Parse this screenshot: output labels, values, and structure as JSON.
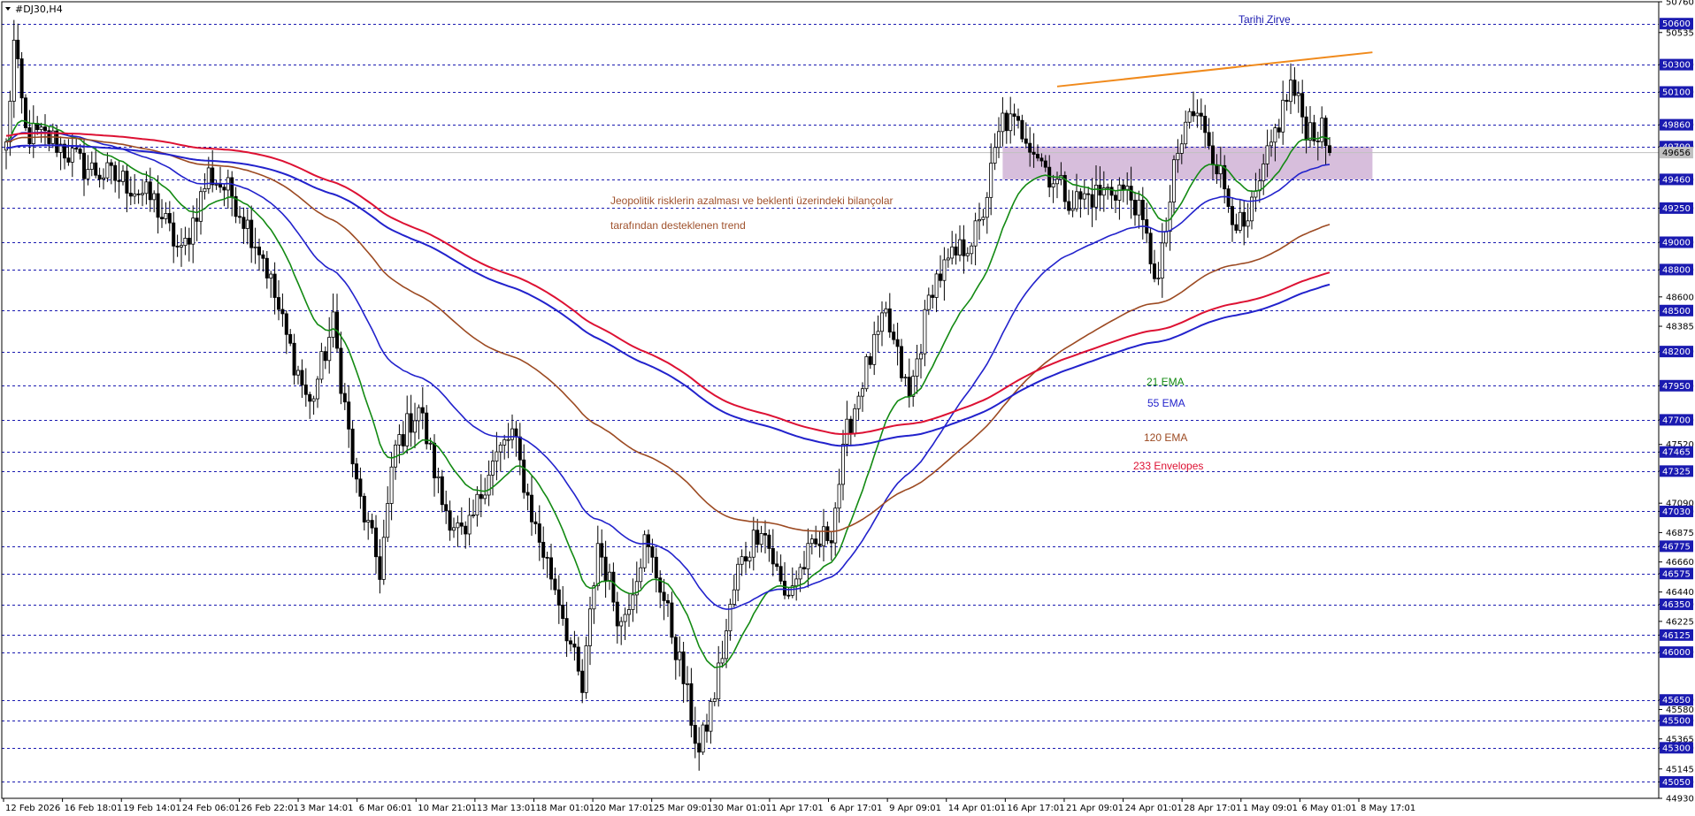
{
  "window": {
    "title": "#DJ30,H4"
  },
  "chart_data": {
    "type": "candlestick",
    "symbol": "#DJ30",
    "timeframe": "H4",
    "ylim": [
      44930,
      50760
    ],
    "y_ticks": [
      "50760",
      "50535",
      "50300",
      "50100",
      "49860",
      "49700",
      "49460",
      "49250",
      "49000",
      "48800",
      "48600",
      "48385",
      "48200",
      "47950",
      "47700",
      "47520",
      "47465",
      "47325",
      "47090",
      "47030",
      "46875",
      "46775",
      "46660",
      "46575",
      "46440",
      "46350",
      "46225",
      "46125",
      "46000",
      "45650",
      "45580",
      "45500",
      "45365",
      "45300",
      "45145",
      "45050",
      "44930"
    ],
    "x_ticks": [
      "12 Feb 2026",
      "16 Feb 18:01",
      "19 Feb 14:01",
      "24 Feb 06:01",
      "26 Feb 22:01",
      "3 Mar 14:01",
      "6 Mar 06:01",
      "10 Mar 21:01",
      "13 Mar 13:01",
      "18 Mar 01:01",
      "20 Mar 17:01",
      "25 Mar 09:01",
      "30 Mar 01:01",
      "1 Apr 17:01",
      "6 Apr 17:01",
      "9 Apr 09:01",
      "14 Apr 01:01",
      "16 Apr 17:01",
      "21 Apr 09:01",
      "24 Apr 01:01",
      "28 Apr 17:01",
      "1 May 09:01",
      "6 May 01:01",
      "8 May 17:01"
    ],
    "levels": [
      {
        "price": 50600,
        "label": "50600",
        "color": "#1a1ab0"
      },
      {
        "price": 50300,
        "label": "50300",
        "color": "#1a1ab0"
      },
      {
        "price": 50100,
        "label": "50100",
        "color": "#1a1ab0"
      },
      {
        "price": 49860,
        "label": "49860",
        "color": "#1a1ab0"
      },
      {
        "price": 49700,
        "label": "49700",
        "color": "#1a1ab0"
      },
      {
        "price": 49460,
        "label": "49460",
        "color": "#1a1ab0"
      },
      {
        "price": 49250,
        "label": "49250",
        "color": "#1a1ab0"
      },
      {
        "price": 49000,
        "label": "49000",
        "color": "#1a1ab0"
      },
      {
        "price": 48800,
        "label": "48800",
        "color": "#1a1ab0"
      },
      {
        "price": 48500,
        "label": "48500",
        "color": "#1a1ab0"
      },
      {
        "price": 48200,
        "label": "48200",
        "color": "#1a1ab0"
      },
      {
        "price": 47950,
        "label": "47950",
        "color": "#1a1ab0"
      },
      {
        "price": 47700,
        "label": "47700",
        "color": "#1a1ab0"
      },
      {
        "price": 47465,
        "label": "47465",
        "color": "#1a1ab0"
      },
      {
        "price": 47325,
        "label": "47325",
        "color": "#1a1ab0"
      },
      {
        "price": 47030,
        "label": "47030",
        "color": "#1a1ab0"
      },
      {
        "price": 46775,
        "label": "46775",
        "color": "#1a1ab0"
      },
      {
        "price": 46575,
        "label": "46575",
        "color": "#1a1ab0"
      },
      {
        "price": 46350,
        "label": "46350",
        "color": "#1a1ab0"
      },
      {
        "price": 46125,
        "label": "46125",
        "color": "#1a1ab0"
      },
      {
        "price": 46000,
        "label": "46000",
        "color": "#1a1ab0"
      },
      {
        "price": 45650,
        "label": "45650",
        "color": "#1a1ab0"
      },
      {
        "price": 45500,
        "label": "45500",
        "color": "#1a1ab0"
      },
      {
        "price": 45300,
        "label": "45300",
        "color": "#1a1ab0"
      },
      {
        "price": 45050,
        "label": "45050",
        "color": "#1a1ab0"
      }
    ],
    "current_price": {
      "price": 49656,
      "label": "49656",
      "color": "#c0c0c0"
    },
    "anchors": [
      [
        0,
        49700
      ],
      [
        2,
        50450
      ],
      [
        5,
        49800
      ],
      [
        12,
        49750
      ],
      [
        20,
        49550
      ],
      [
        30,
        49450
      ],
      [
        38,
        49300
      ],
      [
        45,
        48900
      ],
      [
        52,
        49500
      ],
      [
        58,
        49350
      ],
      [
        66,
        48900
      ],
      [
        72,
        48300
      ],
      [
        78,
        47800
      ],
      [
        84,
        48400
      ],
      [
        90,
        47200
      ],
      [
        96,
        46600
      ],
      [
        100,
        47500
      ],
      [
        106,
        47800
      ],
      [
        112,
        47100
      ],
      [
        118,
        46800
      ],
      [
        124,
        47350
      ],
      [
        130,
        47600
      ],
      [
        136,
        46900
      ],
      [
        142,
        46400
      ],
      [
        148,
        45700
      ],
      [
        152,
        46800
      ],
      [
        158,
        46200
      ],
      [
        164,
        46800
      ],
      [
        168,
        46500
      ],
      [
        174,
        45800
      ],
      [
        178,
        45250
      ],
      [
        182,
        45700
      ],
      [
        188,
        46600
      ],
      [
        194,
        46950
      ],
      [
        200,
        46400
      ],
      [
        206,
        46700
      ],
      [
        212,
        46900
      ],
      [
        216,
        47600
      ],
      [
        220,
        48000
      ],
      [
        226,
        48450
      ],
      [
        232,
        47850
      ],
      [
        238,
        48700
      ],
      [
        244,
        48900
      ],
      [
        250,
        49100
      ],
      [
        256,
        49900
      ],
      [
        262,
        49800
      ],
      [
        268,
        49500
      ],
      [
        274,
        49300
      ],
      [
        280,
        49350
      ],
      [
        286,
        49400
      ],
      [
        290,
        49300
      ],
      [
        296,
        48700
      ],
      [
        300,
        49500
      ],
      [
        304,
        49950
      ],
      [
        308,
        49850
      ],
      [
        314,
        49300
      ],
      [
        318,
        49050
      ],
      [
        322,
        49400
      ],
      [
        326,
        49800
      ],
      [
        330,
        50150
      ],
      [
        334,
        49850
      ],
      [
        338,
        49800
      ],
      [
        340,
        49656
      ]
    ],
    "series": [
      {
        "name": "21 EMA",
        "type": "ema",
        "period": 21,
        "color": "#138a13"
      },
      {
        "name": "55 EMA",
        "type": "ema",
        "period": 55,
        "color": "#2222cc"
      },
      {
        "name": "120 EMA",
        "type": "ema",
        "period": 120,
        "color": "#9c4a22"
      },
      {
        "name": "233 Envelopes",
        "type": "envelopes",
        "period": 233,
        "color": "#dd1133"
      }
    ],
    "zone": {
      "from_price": 49460,
      "to_price": 49700,
      "color": "#c9a8d0"
    },
    "trendline": {
      "points": [
        [
          270,
          50140
        ],
        [
          351,
          50390
        ]
      ],
      "color": "#f08a1c"
    },
    "annotations": {
      "peak": {
        "text": "Tarihi Zirve",
        "color": "#1a1ab0"
      },
      "trend_line1": {
        "text": "Jeopolitik risklerin azalması ve beklenti üzerindeki bilançolar",
        "color": "#a0522d"
      },
      "trend_line2": {
        "text": "tarafından desteklenen trend",
        "color": "#a0522d"
      }
    },
    "legend_labels": [
      {
        "text": "21 EMA",
        "color": "#138a13"
      },
      {
        "text": "55 EMA",
        "color": "#2222cc"
      },
      {
        "text": "120 EMA",
        "color": "#9c4a22"
      },
      {
        "text": "233 Envelopes",
        "color": "#dd1133"
      }
    ]
  }
}
